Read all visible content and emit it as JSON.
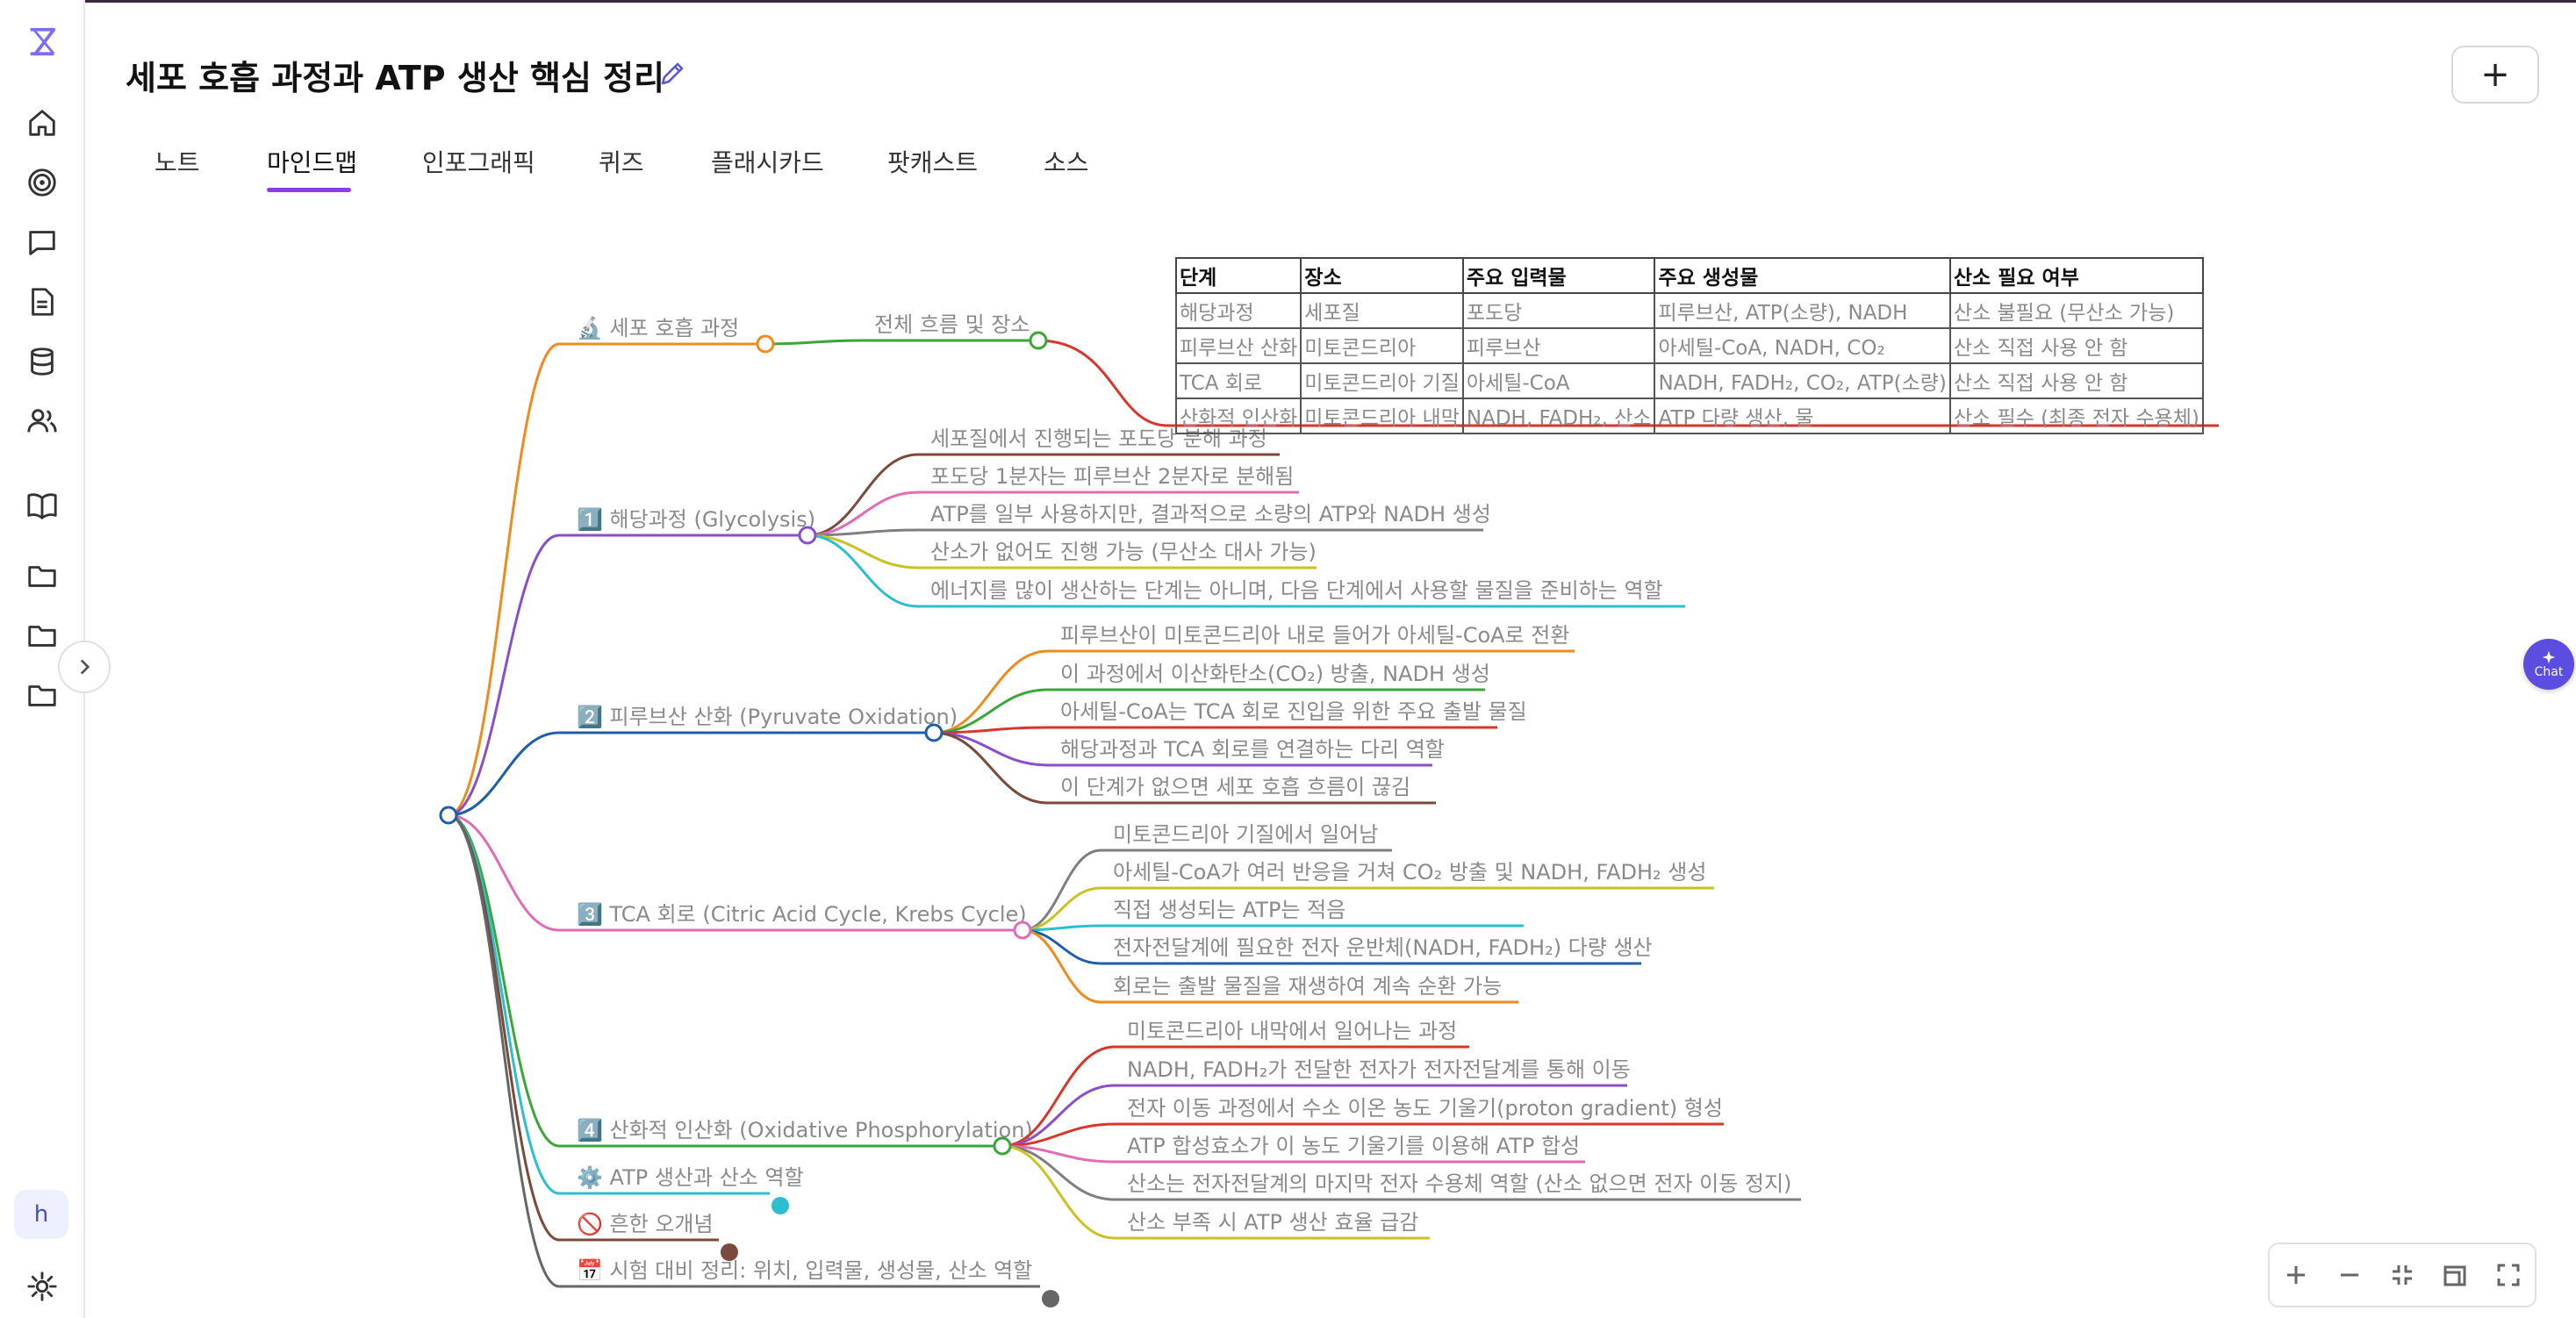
{
  "page": {
    "title": "세포 호흡 과정과 ATP 생산 핵심 정리"
  },
  "tabs": [
    {
      "label": "노트",
      "active": false
    },
    {
      "label": "마인드맵",
      "active": true
    },
    {
      "label": "인포그래픽",
      "active": false
    },
    {
      "label": "퀴즈",
      "active": false
    },
    {
      "label": "플래시카드",
      "active": false
    },
    {
      "label": "팟캐스트",
      "active": false
    },
    {
      "label": "소스",
      "active": false
    }
  ],
  "sidebar": {
    "icons": [
      "logo-icon",
      "home-icon",
      "target-icon",
      "chat-icon",
      "document-icon",
      "database-icon",
      "users-icon",
      "book-icon",
      "folder-icon",
      "folder-icon",
      "folder-icon"
    ],
    "avatar_initial": "h",
    "settings_icon": "gear-icon"
  },
  "toolbar": {
    "add_label": "+"
  },
  "chat_widget": {
    "label": "Chat"
  },
  "zoom_controls": [
    "zoom-in-icon",
    "zoom-out-icon",
    "collapse-icon",
    "fit-icon",
    "fullscreen-icon"
  ],
  "mindmap": {
    "branches": [
      {
        "label": "🔬 세포 호흡 과정",
        "color": "#ef8a1e",
        "children": [
          {
            "label": "전체 흐름 및 장소",
            "color": "#3aa63a"
          }
        ]
      },
      {
        "label": "1️⃣ 해당과정 (Glycolysis)",
        "color": "#8a4fc8",
        "children": [
          {
            "label": "세포질에서 진행되는 포도당 분해 과정",
            "color": "#7a4a3a"
          },
          {
            "label": "포도당 1분자는 피루브산 2분자로 분해됨",
            "color": "#e26bb7"
          },
          {
            "label": "ATP를 일부 사용하지만, 결과적으로 소량의 ATP와 NADH 생성",
            "color": "#7f7f7f"
          },
          {
            "label": "산소가 없어도 진행 가능 (무산소 대사 가능)",
            "color": "#c9c220"
          },
          {
            "label": "에너지를 많이 생산하는 단계는 아니며, 다음 단계에서 사용할 물질을 준비하는 역할",
            "color": "#2bbfd0"
          }
        ]
      },
      {
        "label": "2️⃣ 피루브산 산화 (Pyruvate Oxidation)",
        "color": "#1f5fa8",
        "children": [
          {
            "label": "피루브산이 미토콘드리아 내로 들어가 아세틸-CoA로 전환",
            "color": "#ef8a1e"
          },
          {
            "label": "이 과정에서 이산화탄소(CO₂) 방출, NADH 생성",
            "color": "#3aa63a"
          },
          {
            "label": "아세틸-CoA는 TCA 회로 진입을 위한 주요 출발 물질",
            "color": "#d9352b"
          },
          {
            "label": "해당과정과 TCA 회로를 연결하는 다리 역할",
            "color": "#8a4fc8"
          },
          {
            "label": "이 단계가 없으면 세포 호흡 흐름이 끊김",
            "color": "#7a4a3a"
          }
        ]
      },
      {
        "label": "3️⃣ TCA 회로 (Citric Acid Cycle, Krebs Cycle)",
        "color": "#e26bb7",
        "children": [
          {
            "label": "미토콘드리아 기질에서 일어남",
            "color": "#7f7f7f"
          },
          {
            "label": "아세틸-CoA가 여러 반응을 거쳐 CO₂ 방출 및 NADH, FADH₂ 생성",
            "color": "#c9c220"
          },
          {
            "label": "직접 생성되는 ATP는 적음",
            "color": "#2bbfd0"
          },
          {
            "label": "전자전달계에 필요한 전자 운반체(NADH, FADH₂) 다량 생산",
            "color": "#1f5fa8"
          },
          {
            "label": "회로는 출발 물질을 재생하여 계속 순환 가능",
            "color": "#ef8a1e"
          }
        ]
      },
      {
        "label": "4️⃣ 산화적 인산화 (Oxidative Phosphorylation)",
        "color": "#3aa63a",
        "children": [
          {
            "label": "미토콘드리아 내막에서 일어나는 과정",
            "color": "#d9352b"
          },
          {
            "label": "NADH, FADH₂가 전달한 전자가 전자전달계를 통해 이동",
            "color": "#8a4fc8"
          },
          {
            "label": "전자 이동 과정에서 수소 이온 농도 기울기(proton gradient) 형성",
            "color": "#d9352b"
          },
          {
            "label": "ATP 합성효소가 이 농도 기울기를 이용해 ATP 합성",
            "color": "#e26bb7"
          },
          {
            "label": "산소는 전자전달계의 마지막 전자 수용체 역할 (산소 없으면 전자 이동 정지)",
            "color": "#7f7f7f"
          },
          {
            "label": "산소 부족 시 ATP 생산 효율 급감",
            "color": "#c9c220"
          }
        ]
      },
      {
        "label": "⚙️ ATP 생산과 산소 역할",
        "color": "#2bbfd0",
        "children": []
      },
      {
        "label": "🚫 흔한 오개념",
        "color": "#7a4a3a",
        "children": []
      },
      {
        "label": "📅 시험 대비 정리: 위치, 입력물, 생성물, 산소 역할",
        "color": "#666666",
        "children": []
      }
    ],
    "table": {
      "headers": [
        "단계",
        "장소",
        "주요 입력물",
        "주요 생성물",
        "산소 필요 여부"
      ],
      "rows": [
        [
          "해당과정",
          "세포질",
          "포도당",
          "피루브산, ATP(소량), NADH",
          "산소 불필요 (무산소 가능)"
        ],
        [
          "피루브산 산화",
          "미토콘드리아",
          "피루브산",
          "아세틸-CoA, NADH, CO₂",
          "산소 직접 사용 안 함"
        ],
        [
          "TCA 회로",
          "미토콘드리아 기질",
          "아세틸-CoA",
          "NADH, FADH₂, CO₂, ATP(소량)",
          "산소 직접 사용 안 함"
        ],
        [
          "산화적 인산화",
          "미토콘드리아 내막",
          "NADH, FADH₂, 산소",
          "ATP 다량 생산, 물",
          "산소 필수 (최종 전자 수용체)"
        ]
      ]
    }
  }
}
